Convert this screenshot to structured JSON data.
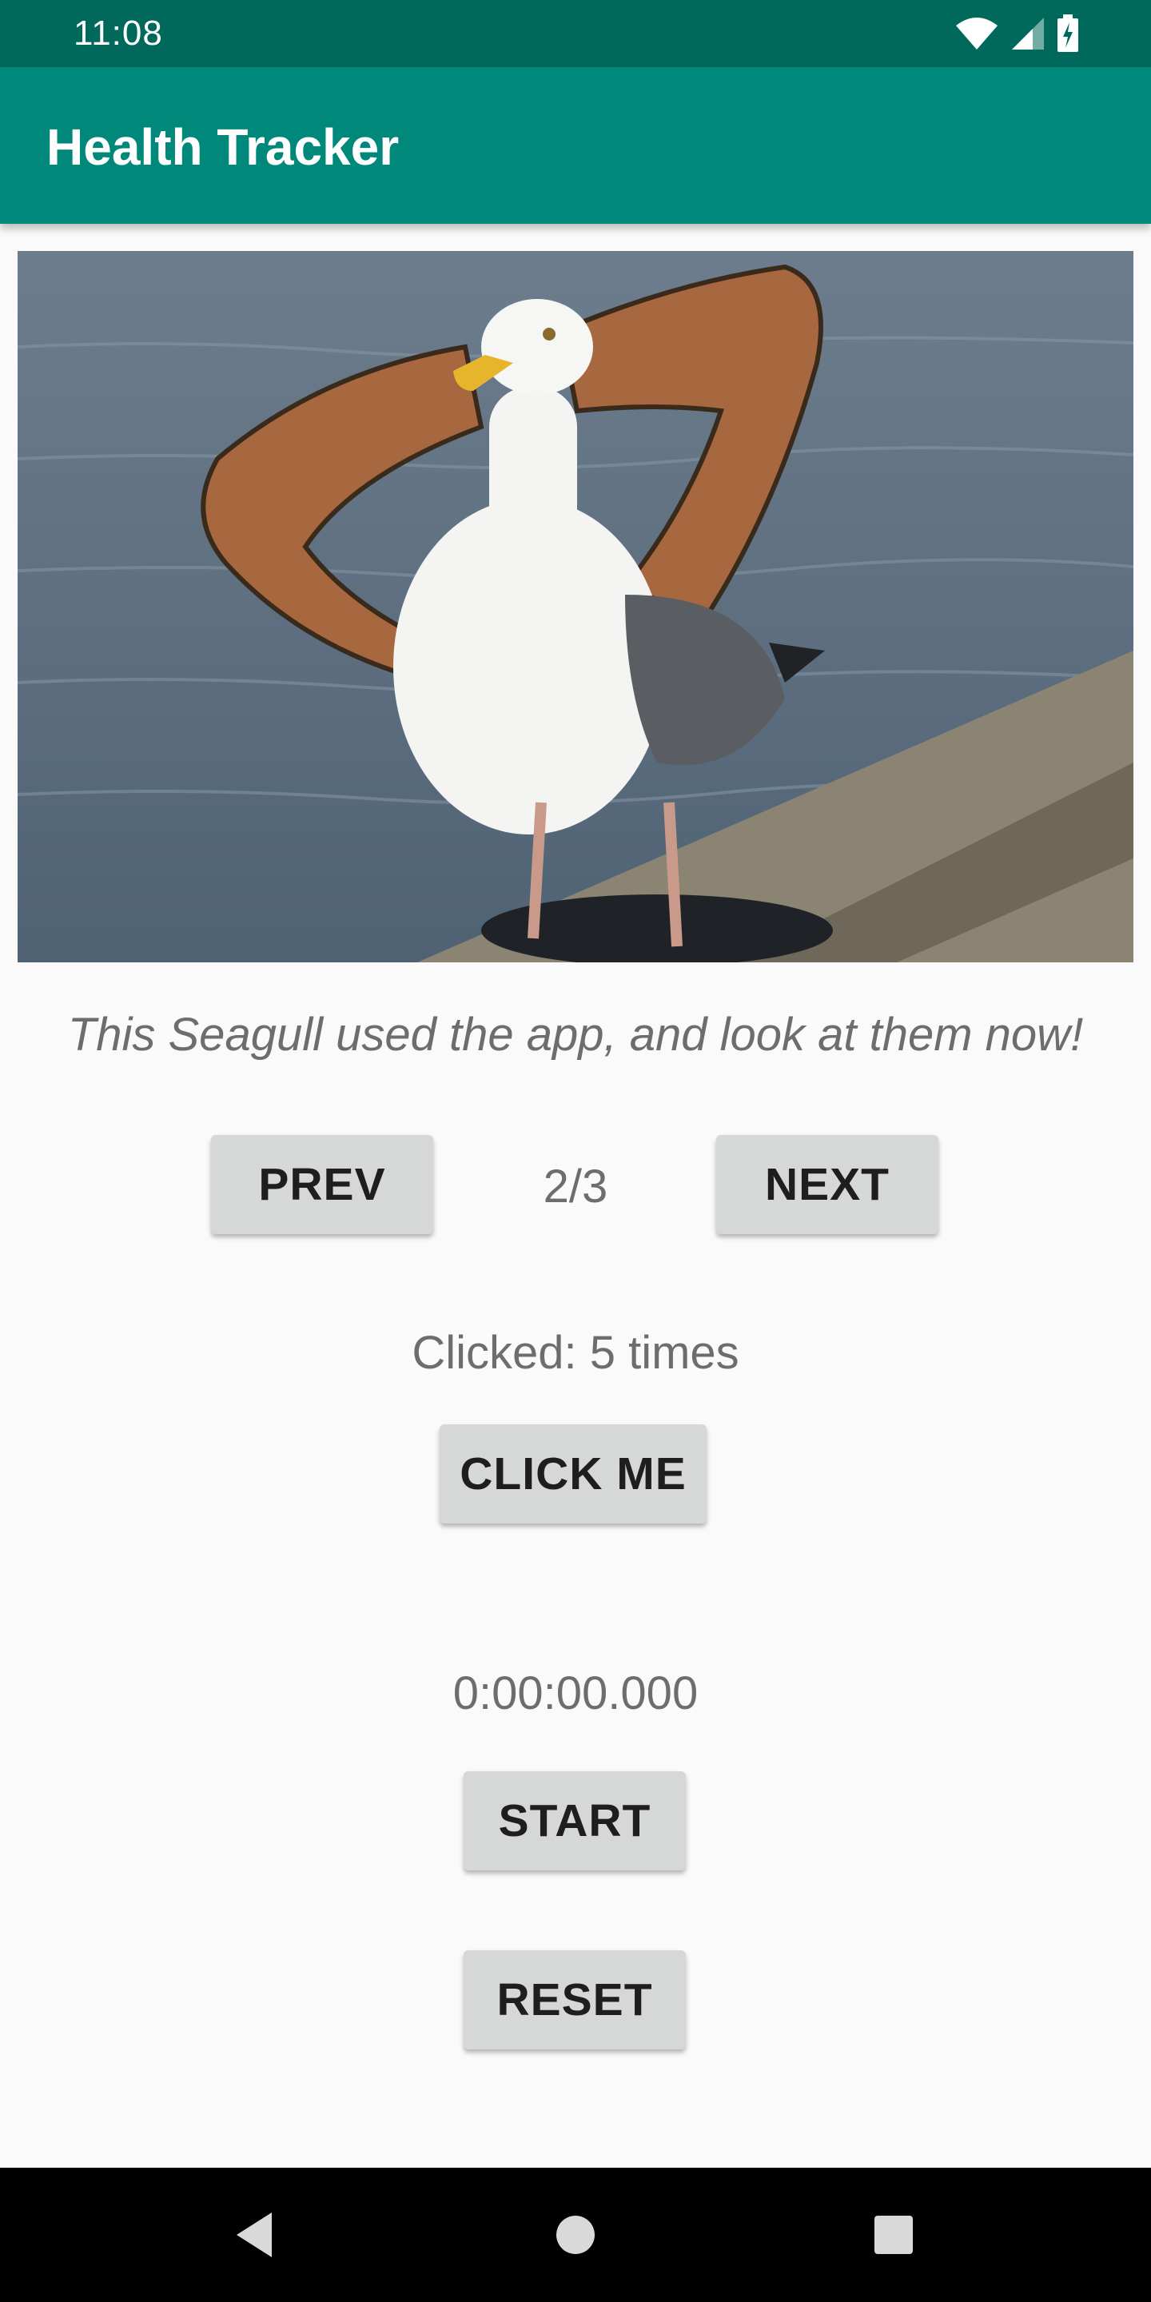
{
  "status_bar": {
    "time": "11:08",
    "icons": [
      "wifi-icon",
      "signal-icon",
      "battery-charging-icon"
    ]
  },
  "app_bar": {
    "title": "Health Tracker"
  },
  "gallery": {
    "image": "seagull-with-muscular-arms-image",
    "caption": "This Seagull used the app, and look at them now!",
    "prev_label": "PREV",
    "next_label": "NEXT",
    "page_indicator": "2/3"
  },
  "counter": {
    "text": "Clicked: 5 times",
    "button_label": "CLICK ME"
  },
  "stopwatch": {
    "time": "0:00:00.000",
    "start_label": "START",
    "reset_label": "RESET"
  },
  "nav_bar": {
    "icons": [
      "back-icon",
      "home-icon",
      "recents-icon"
    ]
  },
  "colors": {
    "status_bar": "#00695c",
    "app_bar": "#00897b",
    "background": "#fafafa",
    "button": "#d6d7d7",
    "secondary_text": "#6d6d6d"
  }
}
